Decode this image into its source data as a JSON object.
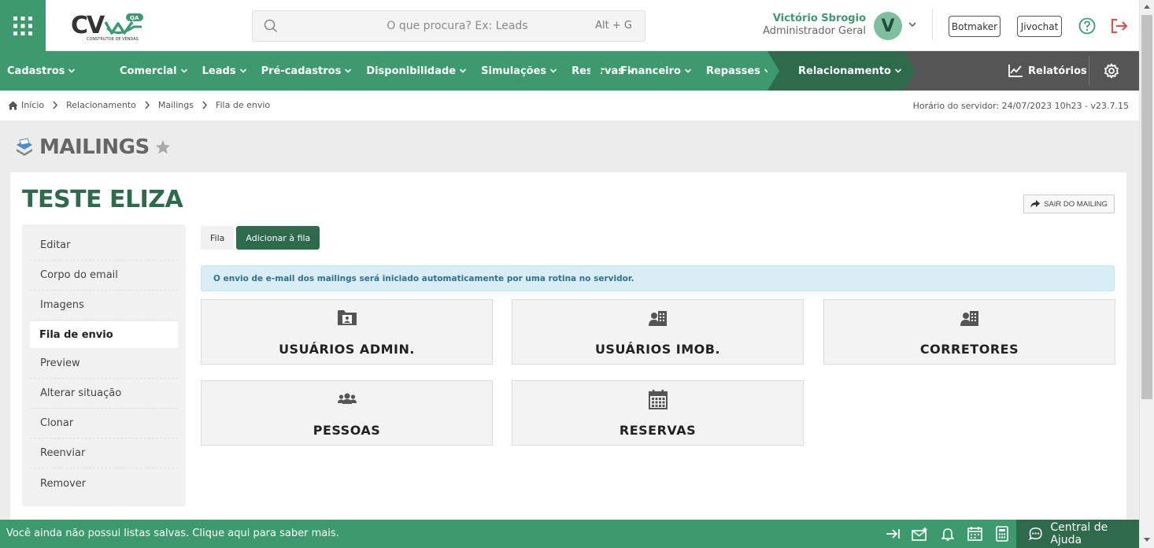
{
  "header": {
    "search_placeholder": "O que procura? Ex: Leads",
    "search_shortcut": "Alt + G",
    "user_name": "Victório Sbrogio",
    "user_role": "Administrador Geral",
    "avatar_letter": "V",
    "botmaker_label": "Botmaker",
    "jivochat_label": "Jivochat"
  },
  "logo": {
    "text": "CV",
    "badge": "QA",
    "subtitle": "CONSTRUTOR DE VENDAS"
  },
  "nav": {
    "groups": [
      {
        "items": [
          "Cadastros"
        ]
      },
      {
        "items": [
          "Comercial",
          "Leads",
          "Pré-cadastros",
          "Disponibilidade",
          "Simulações",
          "Reservas"
        ]
      },
      {
        "items": [
          "Financeiro",
          "Repasses"
        ]
      },
      {
        "items": [
          "Relacionamento"
        ]
      }
    ],
    "reports_label": "Relatórios"
  },
  "breadcrumb": {
    "items": [
      "Início",
      "Relacionamento",
      "Mailings",
      "Fila de envio"
    ],
    "server_time": "Horário do servidor: 24/07/2023 10h23 - v23.7.15"
  },
  "page": {
    "title": "MAILINGS"
  },
  "mailing": {
    "name": "TESTE ELIZA",
    "exit_label": "SAIR DO MAILING",
    "menu": [
      "Editar",
      "Corpo do email",
      "Imagens",
      "Fila de envio",
      "Preview",
      "Alterar situação",
      "Clonar",
      "Reenviar",
      "Remover"
    ],
    "active_menu_index": 3,
    "tabs": [
      "Fila",
      "Adicionar à fila"
    ],
    "alert": "O envio de e-mail dos mailings será iniciado automaticamente por uma rotina no servidor.",
    "tiles": [
      {
        "label": "USUÁRIOS ADMIN.",
        "icon": "id-card-folder-icon"
      },
      {
        "label": "USUÁRIOS IMOB.",
        "icon": "user-building-icon"
      },
      {
        "label": "CORRETORES",
        "icon": "user-building-icon"
      },
      {
        "label": "PESSOAS",
        "icon": "users-group-icon"
      },
      {
        "label": "RESERVAS",
        "icon": "calendar-icon"
      }
    ]
  },
  "footer": {
    "message": "Você ainda não possui listas salvas. Clique aqui para saber mais.",
    "help_label": "Central de Ajuda"
  },
  "colors": {
    "brand_green": "#3d9a6e",
    "dark_green": "#2e6a4c",
    "nav_gray": "#555555",
    "logout_red": "#d9534f"
  }
}
